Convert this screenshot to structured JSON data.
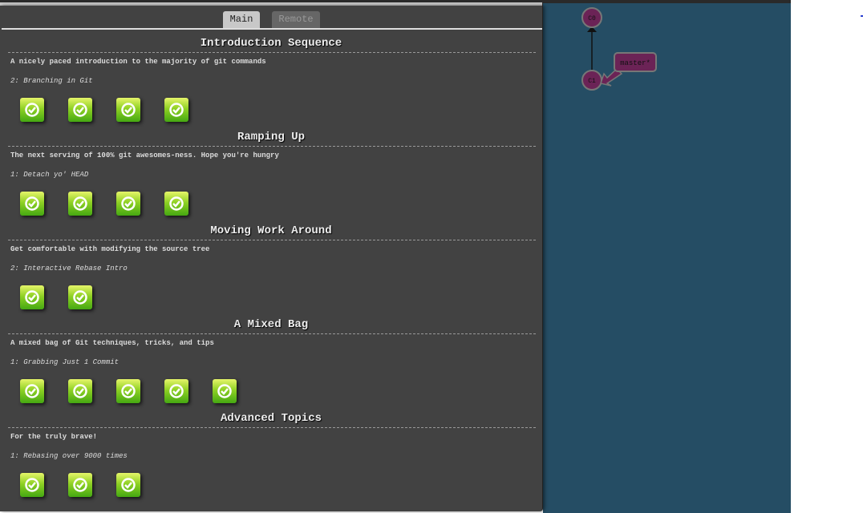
{
  "tabs": {
    "main": "Main",
    "remote": "Remote"
  },
  "sections": [
    {
      "title": "Introduction Sequence",
      "desc": "A nicely paced introduction to the majority of git commands",
      "level": "2: Branching in Git",
      "completed": 4
    },
    {
      "title": "Ramping Up",
      "desc": "The next serving of 100% git awesomes-ness. Hope you're hungry",
      "level": "1: Detach yo' HEAD",
      "completed": 4
    },
    {
      "title": "Moving Work Around",
      "desc": "Get comfortable with modifying the source tree",
      "level": "2: Interactive Rebase Intro",
      "completed": 2
    },
    {
      "title": "A Mixed Bag",
      "desc": "A mixed bag of Git techniques, tricks, and tips",
      "level": "1: Grabbing Just 1 Commit",
      "completed": 5
    },
    {
      "title": "Advanced Topics",
      "desc": "For the truly brave!",
      "level": "1: Rebasing over 9000 times",
      "completed": 3
    }
  ],
  "graph": {
    "commits": [
      "C0",
      "C1"
    ],
    "branch": "master*"
  },
  "colors": {
    "canvas": "#254d64",
    "panel": "#424242",
    "commit": "#6b2356",
    "branch": "#6b2356"
  }
}
